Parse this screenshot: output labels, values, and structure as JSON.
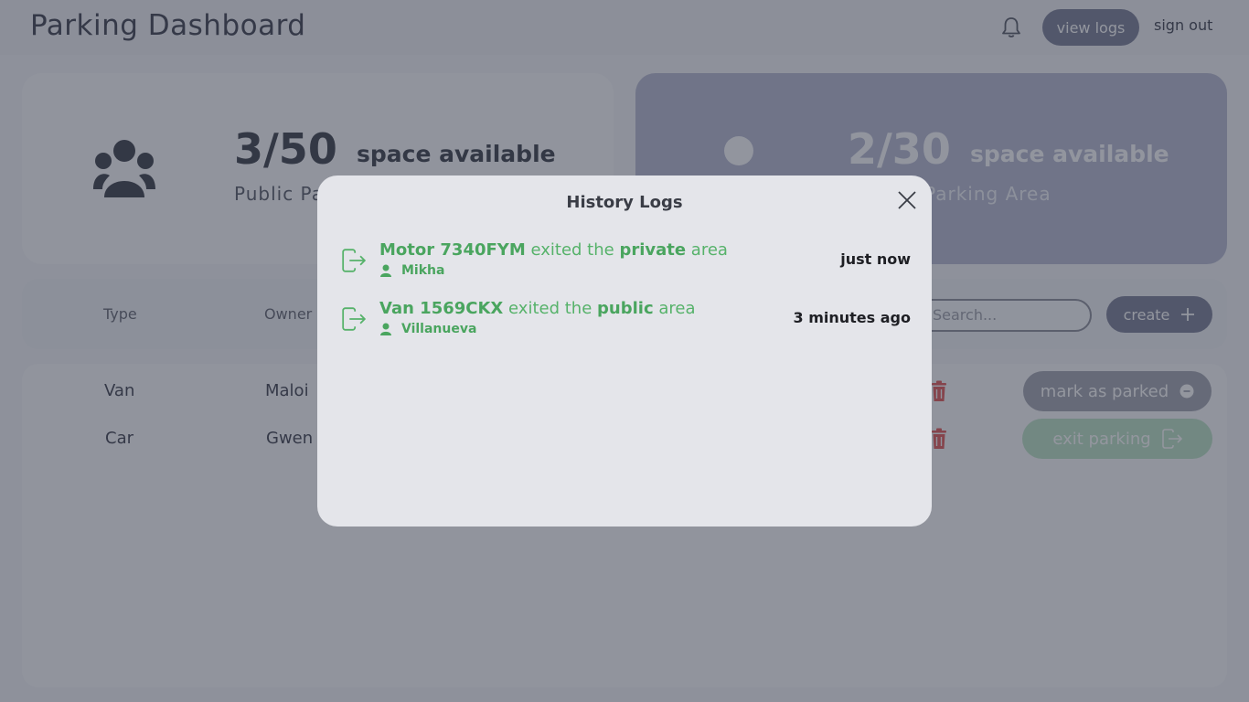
{
  "header": {
    "title": "Parking Dashboard",
    "view_logs_label": "view logs",
    "sign_out_label": "sign out"
  },
  "cards": {
    "public": {
      "count": "3/50",
      "label": "space available",
      "area": "Public Parking Area"
    },
    "private": {
      "count": "2/30",
      "label": "space available",
      "area": "Private Parking Area"
    }
  },
  "filter": {
    "columns": [
      "Type",
      "Owner"
    ],
    "search_placeholder": "Search...",
    "create_label": "create"
  },
  "table": {
    "rows": [
      {
        "type": "Van",
        "owner": "Maloi",
        "action": "mark as parked"
      },
      {
        "type": "Car",
        "owner": "Gwen",
        "action": "exit parking"
      }
    ]
  },
  "modal": {
    "title": "History Logs",
    "logs": [
      {
        "vehicle": "Motor 7340FYM",
        "verb": "exited the",
        "area": "private",
        "suffix": "area",
        "user": "Mikha",
        "time": "just now"
      },
      {
        "vehicle": "Van 1569CKX",
        "verb": "exited the",
        "area": "public",
        "suffix": "area",
        "user": "Villanueva",
        "time": "3 minutes ago"
      }
    ]
  },
  "colors": {
    "accent": "#7d8099",
    "success": "#4aa55f",
    "danger": "#e25b5b",
    "overlay": "#282d3e"
  },
  "icons": [
    "bell-icon",
    "group-icon",
    "person-icon",
    "plus-icon",
    "trash-icon",
    "minus-circle-icon",
    "exit-icon",
    "close-icon",
    "user-icon"
  ]
}
